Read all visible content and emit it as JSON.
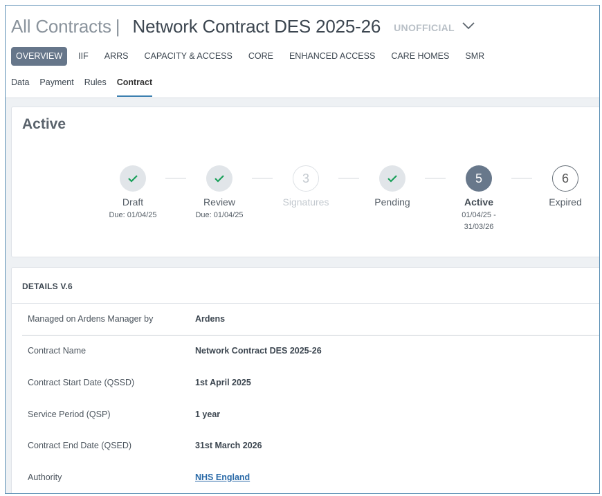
{
  "header": {
    "breadcrumb": "All Contracts",
    "separator": "|",
    "title": "Network Contract DES 2025-26",
    "badge": "UNOFFICIAL"
  },
  "main_tabs": [
    {
      "label": "OVERVIEW",
      "active": true
    },
    {
      "label": "IIF",
      "active": false
    },
    {
      "label": "ARRS",
      "active": false
    },
    {
      "label": "CAPACITY & ACCESS",
      "active": false
    },
    {
      "label": "CORE",
      "active": false
    },
    {
      "label": "ENHANCED ACCESS",
      "active": false
    },
    {
      "label": "CARE HOMES",
      "active": false
    },
    {
      "label": "SMR",
      "active": false
    }
  ],
  "sub_tabs": [
    {
      "label": "Data",
      "active": false
    },
    {
      "label": "Payment",
      "active": false
    },
    {
      "label": "Rules",
      "active": false
    },
    {
      "label": "Contract",
      "active": true
    }
  ],
  "status": {
    "title": "Active",
    "steps": [
      {
        "label": "Draft",
        "state": "done",
        "icon": "check-icon",
        "sub1": "Due: 01/04/25",
        "sub2": ""
      },
      {
        "label": "Review",
        "state": "done",
        "icon": "check-icon",
        "sub1": "Due: 01/04/25",
        "sub2": ""
      },
      {
        "label": "Signatures",
        "state": "skipped",
        "number": "3",
        "sub1": "",
        "sub2": ""
      },
      {
        "label": "Pending",
        "state": "done",
        "icon": "check-icon",
        "sub1": "",
        "sub2": ""
      },
      {
        "label": "Active",
        "state": "current",
        "number": "5",
        "sub1": "01/04/25 -",
        "sub2": "31/03/26"
      },
      {
        "label": "Expired",
        "state": "future",
        "number": "6",
        "sub1": "",
        "sub2": ""
      }
    ]
  },
  "details": {
    "heading": "DETAILS V.6",
    "rows": [
      {
        "label": "Managed on Ardens Manager by",
        "value": "Ardens"
      },
      {
        "label": "Contract Name",
        "value": "Network Contract DES 2025-26"
      },
      {
        "label": "Contract Start Date (QSSD)",
        "value": "1st April 2025"
      },
      {
        "label": "Service Period (QSP)",
        "value": "1 year"
      },
      {
        "label": "Contract End Date (QSED)",
        "value": "31st March 2026"
      },
      {
        "label": "Authority",
        "value": "NHS England",
        "link": true
      }
    ]
  },
  "colors": {
    "check": "#1aa05a",
    "active_tab_bg": "#66768a",
    "link": "#2a6aa8",
    "frame_border": "#5b8fb5"
  }
}
